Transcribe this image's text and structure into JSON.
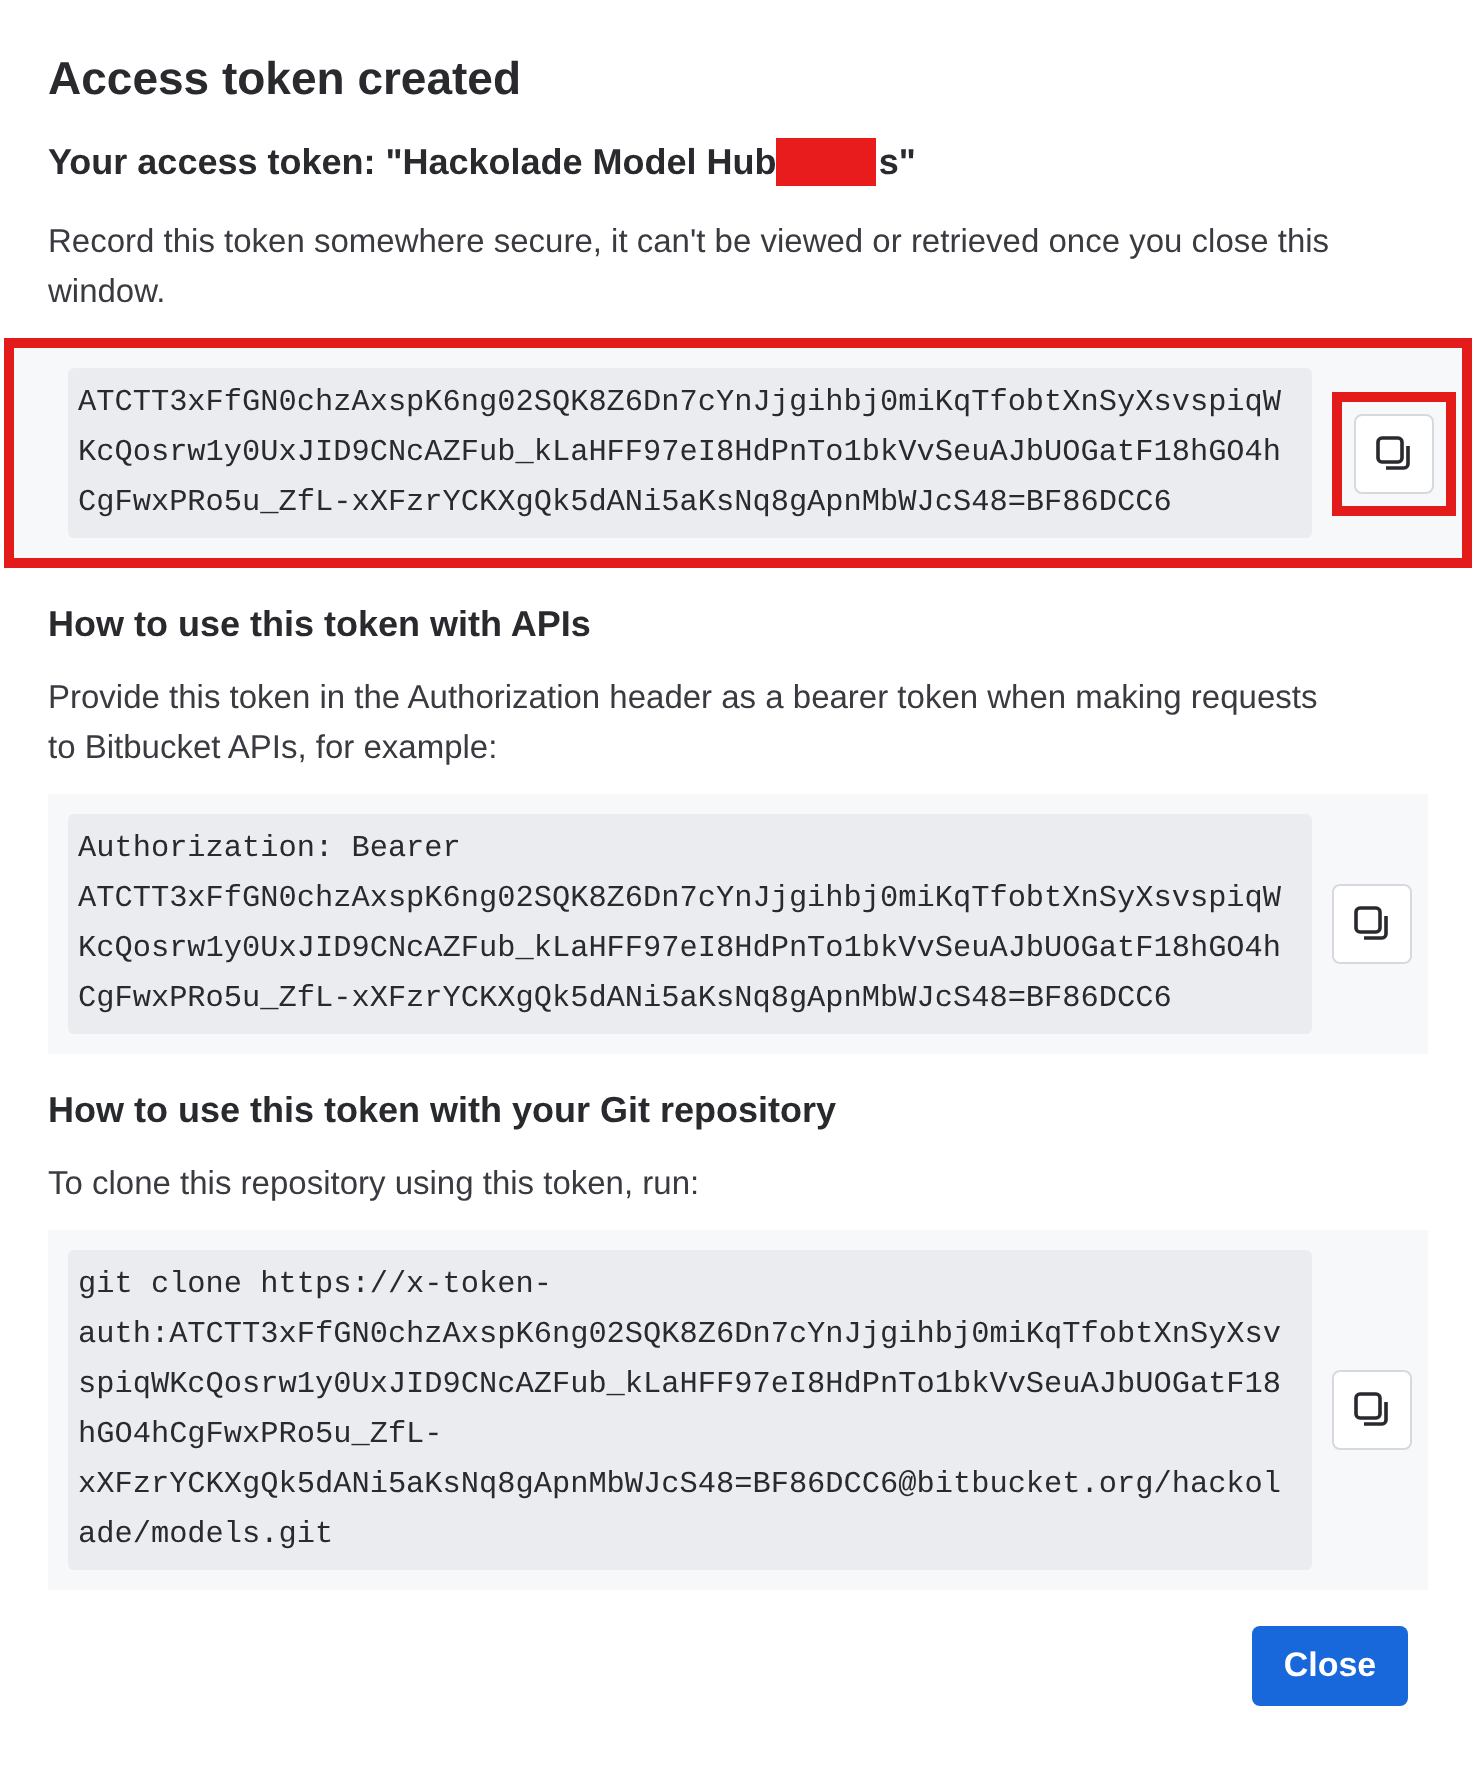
{
  "dialog": {
    "title": "Access token created",
    "token_heading": {
      "before": "Your access token: \"Hackolade Model Hub",
      "redacted": true,
      "after": "s\""
    },
    "token_note": "Record this token somewhere secure, it can't be viewed or retrieved once you close this window.",
    "token_block": {
      "highlighted": true,
      "copy_highlighted": true,
      "lines": [
        "ATCTT3xFfGN0chzAxspK6ng02SQK8Z6Dn7cYnJjgihbj0miKqTfobtXnSyXsvspiqW",
        "KcQosrw1y0UxJID9CNcAZFub_kLaHFF97eI8HdPnTo1bkVvSeuAJbUOGatF18hGO4h",
        "CgFwxPRo5u_ZfL-xXFzrYCKXgQk5dANi5aKsNq8gApnMbWJcS48=BF86DCC6"
      ]
    },
    "sections": [
      {
        "heading": "How to use this token with APIs",
        "text": "Provide this token in the Authorization header as a bearer token when making requests to Bitbucket APIs, for example:",
        "lines": [
          "Authorization: Bearer",
          "ATCTT3xFfGN0chzAxspK6ng02SQK8Z6Dn7cYnJjgihbj0miKqTfobtXnSyXsvspiqW",
          "KcQosrw1y0UxJID9CNcAZFub_kLaHFF97eI8HdPnTo1bkVvSeuAJbUOGatF18hGO4h",
          "CgFwxPRo5u_ZfL-xXFzrYCKXgQk5dANi5aKsNq8gApnMbWJcS48=BF86DCC6"
        ]
      },
      {
        "heading": "How to use this token with your Git repository",
        "text": "To clone this repository using this token, run:",
        "lines": [
          "git clone https://x-token-",
          "auth:ATCTT3xFfGN0chzAxspK6ng02SQK8Z6Dn7cYnJjgihbj0miKqTfobtXnSyXsv",
          "spiqWKcQosrw1y0UxJID9CNcAZFub_kLaHFF97eI8HdPnTo1bkVvSeuAJbUOGatF18",
          "hGO4hCgFwxPRo5u_ZfL-",
          "xXFzrYCKXgQk5dANi5aKsNq8gApnMbWJcS48=BF86DCC6@bitbucket.org/hackol",
          "ade/models.git"
        ]
      }
    ],
    "close_button": "Close"
  }
}
